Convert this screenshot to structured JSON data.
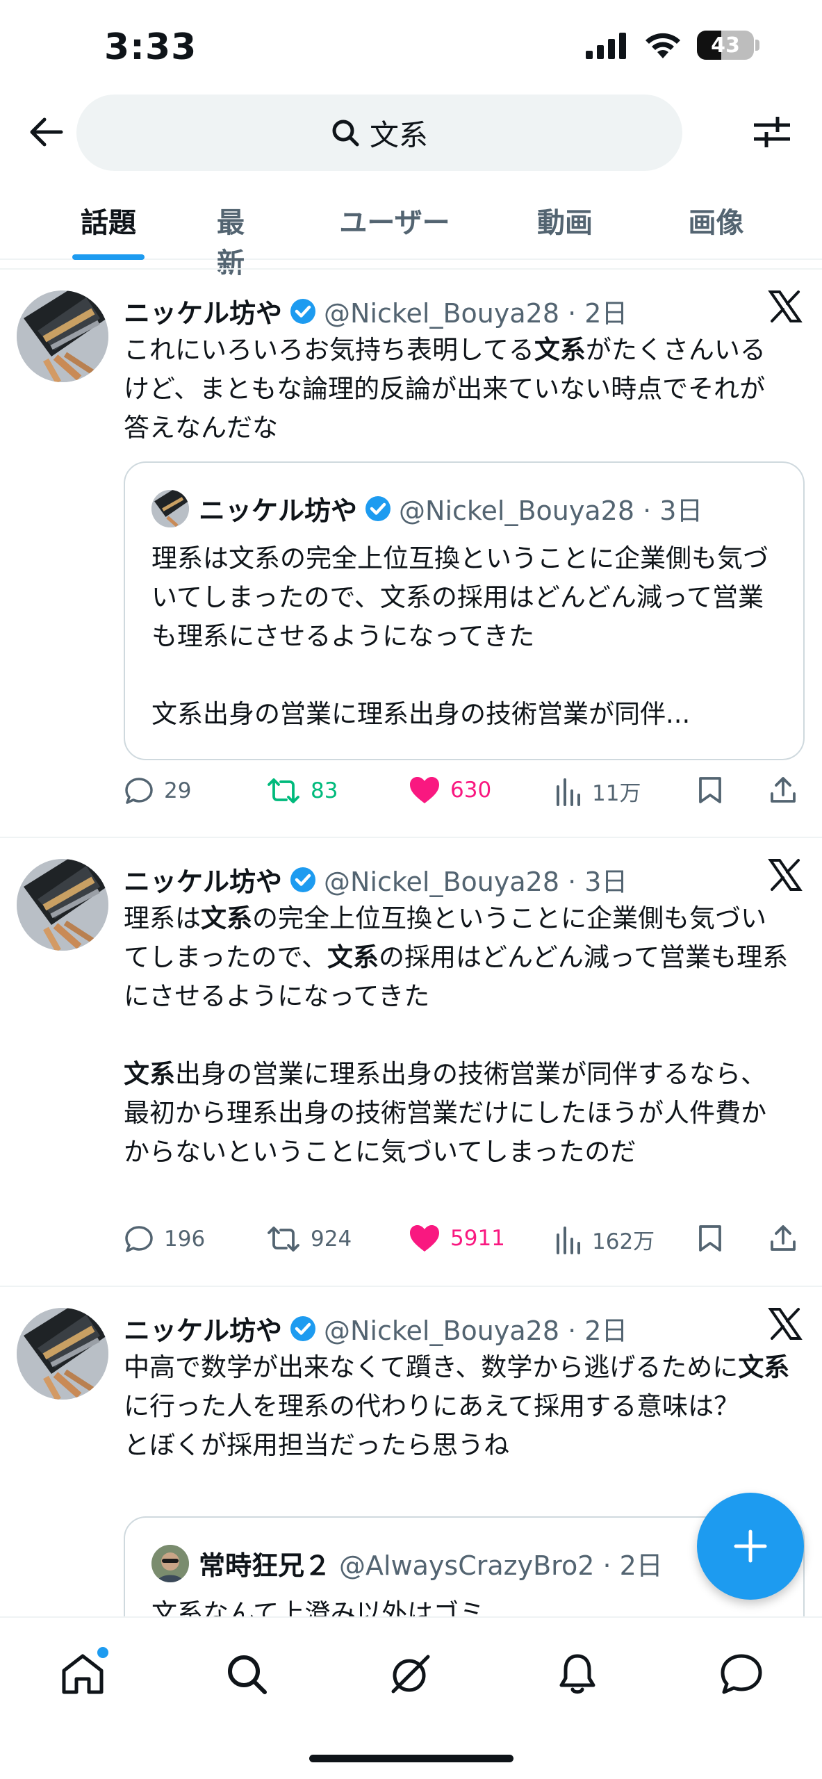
{
  "status_bar": {
    "time": "3:33",
    "battery": "43"
  },
  "search": {
    "query": "文系"
  },
  "tabs": [
    {
      "label": "話題",
      "active": true
    },
    {
      "label": "最新",
      "active": false
    },
    {
      "label": "ユーザー",
      "active": false
    },
    {
      "label": "動画",
      "active": false
    },
    {
      "label": "画像",
      "active": false
    }
  ],
  "tweets": [
    {
      "name": "ニッケル坊や",
      "handle_time": "@Nickel_Bouya28 · 2日",
      "text": "これにいろいろお気持ち表明してる文系がたくさんいるけど、まともな論理的反論が出来ていない時点でそれが答えなんだな",
      "quote": {
        "name": "ニッケル坊や",
        "handle_time": "@Nickel_Bouya28 · 3日",
        "text": "理系は文系の完全上位互換ということに企業側も気づいてしまったので、文系の採用はどんどん減って営業も理系にさせるようになってきた\n\n文系出身の営業に理系出身の技術営業が同伴..."
      },
      "replies": "29",
      "retweets": "83",
      "likes": "630",
      "views": "11万"
    },
    {
      "name": "ニッケル坊や",
      "handle_time": "@Nickel_Bouya28 · 3日",
      "text": "理系は文系の完全上位互換ということに企業側も気づいてしまったので、文系の採用はどんどん減って営業も理系にさせるようになってきた\n\n文系出身の営業に理系出身の技術営業が同伴するなら、最初から理系出身の技術営業だけにしたほうが人件費かからないということに気づいてしまったのだ",
      "replies": "196",
      "retweets": "924",
      "likes": "5911",
      "views": "162万"
    },
    {
      "name": "ニッケル坊や",
      "handle_time": "@Nickel_Bouya28 · 2日",
      "text": "中高で数学が出来なくて躓き、数学から逃げるために文系に行った人を理系の代わりにあえて採用する意味は？\nとぼくが採用担当だったら思うね",
      "quote": {
        "name": "常時狂兄２",
        "handle_time": "@AlwaysCrazyBro2 · 2日",
        "text": "文系なんて上澄み以外はゴミ"
      }
    }
  ],
  "colors": {
    "accent": "#1d9bf0",
    "retweet": "#00ba7c",
    "like": "#f91880",
    "secondary": "#536471"
  }
}
